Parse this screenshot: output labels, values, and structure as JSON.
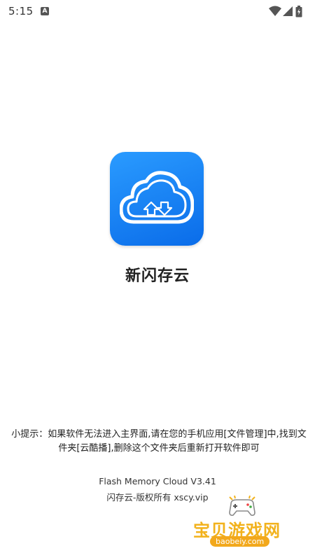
{
  "status_bar": {
    "time": "5:15",
    "indicator": "A",
    "icons": [
      "wifi-icon",
      "signal-icon",
      "battery-icon"
    ]
  },
  "app": {
    "icon": "cloud-sync-icon",
    "name": "新闪存云"
  },
  "tip": "小提示：如果软件无法进入主界面,请在您的手机应用[文件管理]中,找到文件夹[云酷播],删除这个文件夹后重新打开软件即可",
  "footer": {
    "version": "Flash Memory Cloud V3.41",
    "copyright": "闪存云-版权所有 xscy.vip"
  },
  "watermark": {
    "title": "宝贝游戏网",
    "url": "baobeiy.com",
    "icon": "game-controller-icon"
  },
  "colors": {
    "icon_gradient_start": "#2a9bff",
    "icon_gradient_end": "#0a6ce9",
    "watermark": "#f2b21c"
  }
}
